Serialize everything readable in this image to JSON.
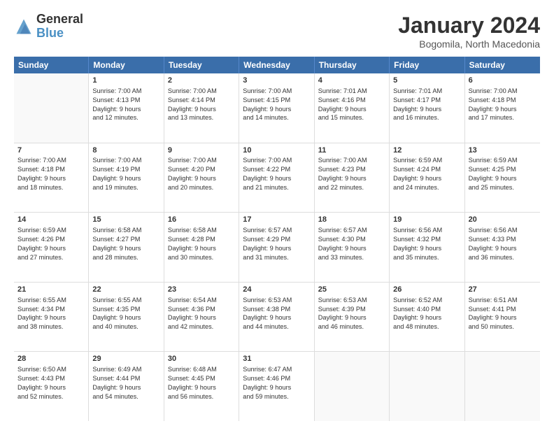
{
  "logo": {
    "general": "General",
    "blue": "Blue"
  },
  "title": "January 2024",
  "location": "Bogomila, North Macedonia",
  "days": [
    "Sunday",
    "Monday",
    "Tuesday",
    "Wednesday",
    "Thursday",
    "Friday",
    "Saturday"
  ],
  "rows": [
    [
      {
        "day": "",
        "content": ""
      },
      {
        "day": "1",
        "content": "Sunrise: 7:00 AM\nSunset: 4:13 PM\nDaylight: 9 hours\nand 12 minutes."
      },
      {
        "day": "2",
        "content": "Sunrise: 7:00 AM\nSunset: 4:14 PM\nDaylight: 9 hours\nand 13 minutes."
      },
      {
        "day": "3",
        "content": "Sunrise: 7:00 AM\nSunset: 4:15 PM\nDaylight: 9 hours\nand 14 minutes."
      },
      {
        "day": "4",
        "content": "Sunrise: 7:01 AM\nSunset: 4:16 PM\nDaylight: 9 hours\nand 15 minutes."
      },
      {
        "day": "5",
        "content": "Sunrise: 7:01 AM\nSunset: 4:17 PM\nDaylight: 9 hours\nand 16 minutes."
      },
      {
        "day": "6",
        "content": "Sunrise: 7:00 AM\nSunset: 4:18 PM\nDaylight: 9 hours\nand 17 minutes."
      }
    ],
    [
      {
        "day": "7",
        "content": "Sunrise: 7:00 AM\nSunset: 4:18 PM\nDaylight: 9 hours\nand 18 minutes."
      },
      {
        "day": "8",
        "content": "Sunrise: 7:00 AM\nSunset: 4:19 PM\nDaylight: 9 hours\nand 19 minutes."
      },
      {
        "day": "9",
        "content": "Sunrise: 7:00 AM\nSunset: 4:20 PM\nDaylight: 9 hours\nand 20 minutes."
      },
      {
        "day": "10",
        "content": "Sunrise: 7:00 AM\nSunset: 4:22 PM\nDaylight: 9 hours\nand 21 minutes."
      },
      {
        "day": "11",
        "content": "Sunrise: 7:00 AM\nSunset: 4:23 PM\nDaylight: 9 hours\nand 22 minutes."
      },
      {
        "day": "12",
        "content": "Sunrise: 6:59 AM\nSunset: 4:24 PM\nDaylight: 9 hours\nand 24 minutes."
      },
      {
        "day": "13",
        "content": "Sunrise: 6:59 AM\nSunset: 4:25 PM\nDaylight: 9 hours\nand 25 minutes."
      }
    ],
    [
      {
        "day": "14",
        "content": "Sunrise: 6:59 AM\nSunset: 4:26 PM\nDaylight: 9 hours\nand 27 minutes."
      },
      {
        "day": "15",
        "content": "Sunrise: 6:58 AM\nSunset: 4:27 PM\nDaylight: 9 hours\nand 28 minutes."
      },
      {
        "day": "16",
        "content": "Sunrise: 6:58 AM\nSunset: 4:28 PM\nDaylight: 9 hours\nand 30 minutes."
      },
      {
        "day": "17",
        "content": "Sunrise: 6:57 AM\nSunset: 4:29 PM\nDaylight: 9 hours\nand 31 minutes."
      },
      {
        "day": "18",
        "content": "Sunrise: 6:57 AM\nSunset: 4:30 PM\nDaylight: 9 hours\nand 33 minutes."
      },
      {
        "day": "19",
        "content": "Sunrise: 6:56 AM\nSunset: 4:32 PM\nDaylight: 9 hours\nand 35 minutes."
      },
      {
        "day": "20",
        "content": "Sunrise: 6:56 AM\nSunset: 4:33 PM\nDaylight: 9 hours\nand 36 minutes."
      }
    ],
    [
      {
        "day": "21",
        "content": "Sunrise: 6:55 AM\nSunset: 4:34 PM\nDaylight: 9 hours\nand 38 minutes."
      },
      {
        "day": "22",
        "content": "Sunrise: 6:55 AM\nSunset: 4:35 PM\nDaylight: 9 hours\nand 40 minutes."
      },
      {
        "day": "23",
        "content": "Sunrise: 6:54 AM\nSunset: 4:36 PM\nDaylight: 9 hours\nand 42 minutes."
      },
      {
        "day": "24",
        "content": "Sunrise: 6:53 AM\nSunset: 4:38 PM\nDaylight: 9 hours\nand 44 minutes."
      },
      {
        "day": "25",
        "content": "Sunrise: 6:53 AM\nSunset: 4:39 PM\nDaylight: 9 hours\nand 46 minutes."
      },
      {
        "day": "26",
        "content": "Sunrise: 6:52 AM\nSunset: 4:40 PM\nDaylight: 9 hours\nand 48 minutes."
      },
      {
        "day": "27",
        "content": "Sunrise: 6:51 AM\nSunset: 4:41 PM\nDaylight: 9 hours\nand 50 minutes."
      }
    ],
    [
      {
        "day": "28",
        "content": "Sunrise: 6:50 AM\nSunset: 4:43 PM\nDaylight: 9 hours\nand 52 minutes."
      },
      {
        "day": "29",
        "content": "Sunrise: 6:49 AM\nSunset: 4:44 PM\nDaylight: 9 hours\nand 54 minutes."
      },
      {
        "day": "30",
        "content": "Sunrise: 6:48 AM\nSunset: 4:45 PM\nDaylight: 9 hours\nand 56 minutes."
      },
      {
        "day": "31",
        "content": "Sunrise: 6:47 AM\nSunset: 4:46 PM\nDaylight: 9 hours\nand 59 minutes."
      },
      {
        "day": "",
        "content": ""
      },
      {
        "day": "",
        "content": ""
      },
      {
        "day": "",
        "content": ""
      }
    ]
  ]
}
